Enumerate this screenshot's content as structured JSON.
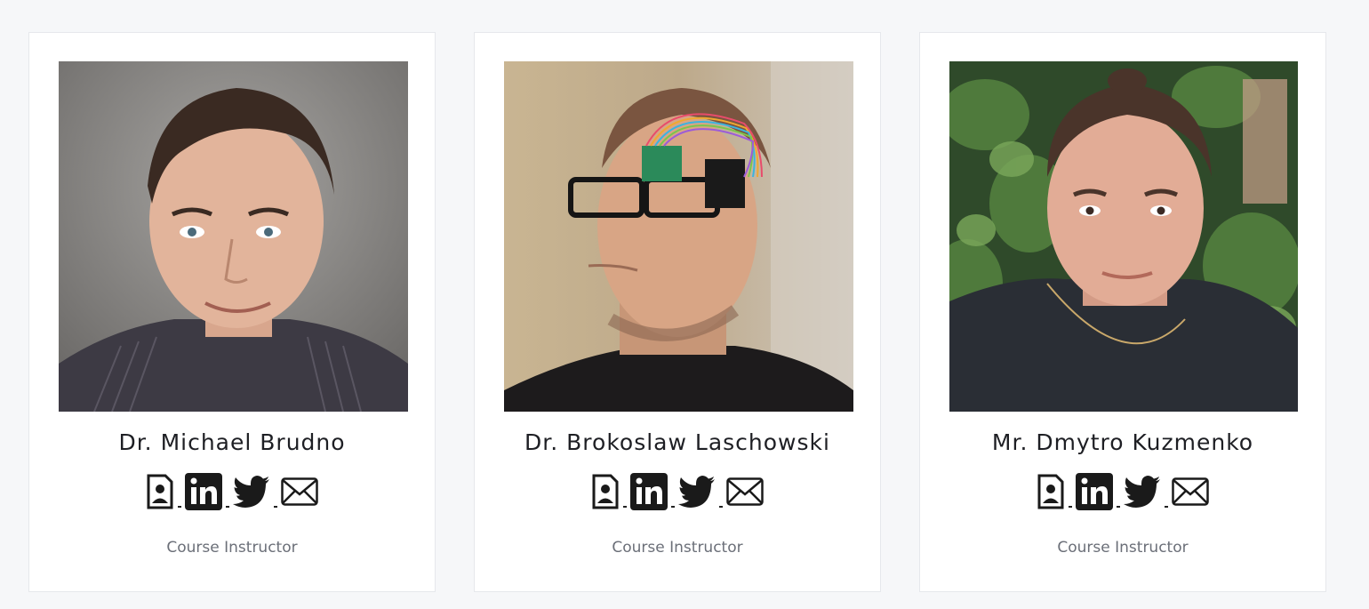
{
  "instructors": [
    {
      "name": "Dr. Michael Brudno",
      "role": "Course Instructor",
      "icons": [
        "profile-icon",
        "linkedin-icon",
        "twitter-icon",
        "email-icon"
      ]
    },
    {
      "name": "Dr. Brokoslaw Laschowski",
      "role": "Course Instructor",
      "icons": [
        "profile-icon",
        "linkedin-icon",
        "twitter-icon",
        "email-icon"
      ]
    },
    {
      "name": "Mr. Dmytro Kuzmenko",
      "role": "Course Instructor",
      "icons": [
        "profile-icon",
        "linkedin-icon",
        "twitter-icon",
        "email-icon"
      ]
    }
  ],
  "colors": {
    "page_bg": "#f6f7f9",
    "card_bg": "#ffffff",
    "card_border": "#e6e8ec",
    "name_text": "#1e1f24",
    "role_text": "#6b6f78",
    "icon": "#1a1a1a"
  }
}
